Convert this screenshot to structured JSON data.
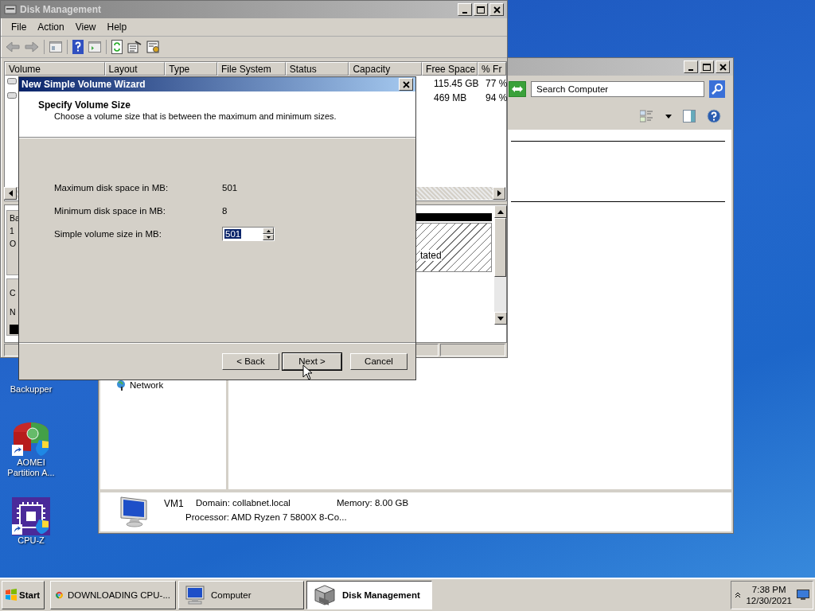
{
  "desktop_icons": [
    {
      "kind": "backup",
      "lines": [
        "Backupper"
      ]
    },
    {
      "kind": "partition",
      "lines": [
        "AOMEI",
        "Partition A..."
      ]
    },
    {
      "kind": "cpu",
      "lines": [
        "CPU-Z"
      ]
    }
  ],
  "computer_window": {
    "search": {
      "placeholder": "Search Computer"
    },
    "nav_items": [
      {
        "label": "Network"
      }
    ],
    "details": {
      "name": "VM1",
      "domain": "Domain: collabnet.local",
      "memory": "Memory: 8.00 GB",
      "processor": "Processor: AMD Ryzen 7 5800X 8-Co..."
    }
  },
  "disk_management": {
    "title": "Disk Management",
    "menu": [
      "File",
      "Action",
      "View",
      "Help"
    ],
    "columns": [
      "Volume",
      "Layout",
      "Type",
      "File System",
      "Status",
      "Capacity",
      "Free Space",
      "% Fr"
    ],
    "rows": [
      {
        "free_space": "115.45 GB",
        "percent_free": "77 %"
      },
      {
        "free_space": "469 MB",
        "percent_free": "94 %"
      }
    ],
    "disk_labels": [
      [
        "Ba",
        "1",
        "O"
      ],
      [
        "C",
        "N"
      ]
    ],
    "unallocated_label": "tated"
  },
  "wizard": {
    "title": "New Simple Volume Wizard",
    "heading": "Specify Volume Size",
    "subtitle": "Choose a volume size that is between the maximum and minimum sizes.",
    "fields": [
      {
        "label": "Maximum disk space in MB:",
        "value": "501",
        "kind": "readout"
      },
      {
        "label": "Minimum disk space in MB:",
        "value": "8",
        "kind": "readout"
      },
      {
        "label": "Simple volume size in MB:",
        "value": "501",
        "kind": "spinner"
      }
    ],
    "buttons": [
      {
        "label": "< Back",
        "default": false
      },
      {
        "label": "Next >",
        "default": true
      },
      {
        "label": "Cancel",
        "default": false
      }
    ]
  },
  "taskbar": {
    "start": "Start",
    "buttons": [
      {
        "kind": "browser",
        "label": "DOWNLOADING CPU-...",
        "selected": false
      },
      {
        "kind": "computer",
        "label": "Computer",
        "selected": false
      },
      {
        "kind": "disk",
        "label": "Disk Management",
        "selected": true
      }
    ],
    "time": "7:38 PM",
    "date": "12/30/2021"
  }
}
